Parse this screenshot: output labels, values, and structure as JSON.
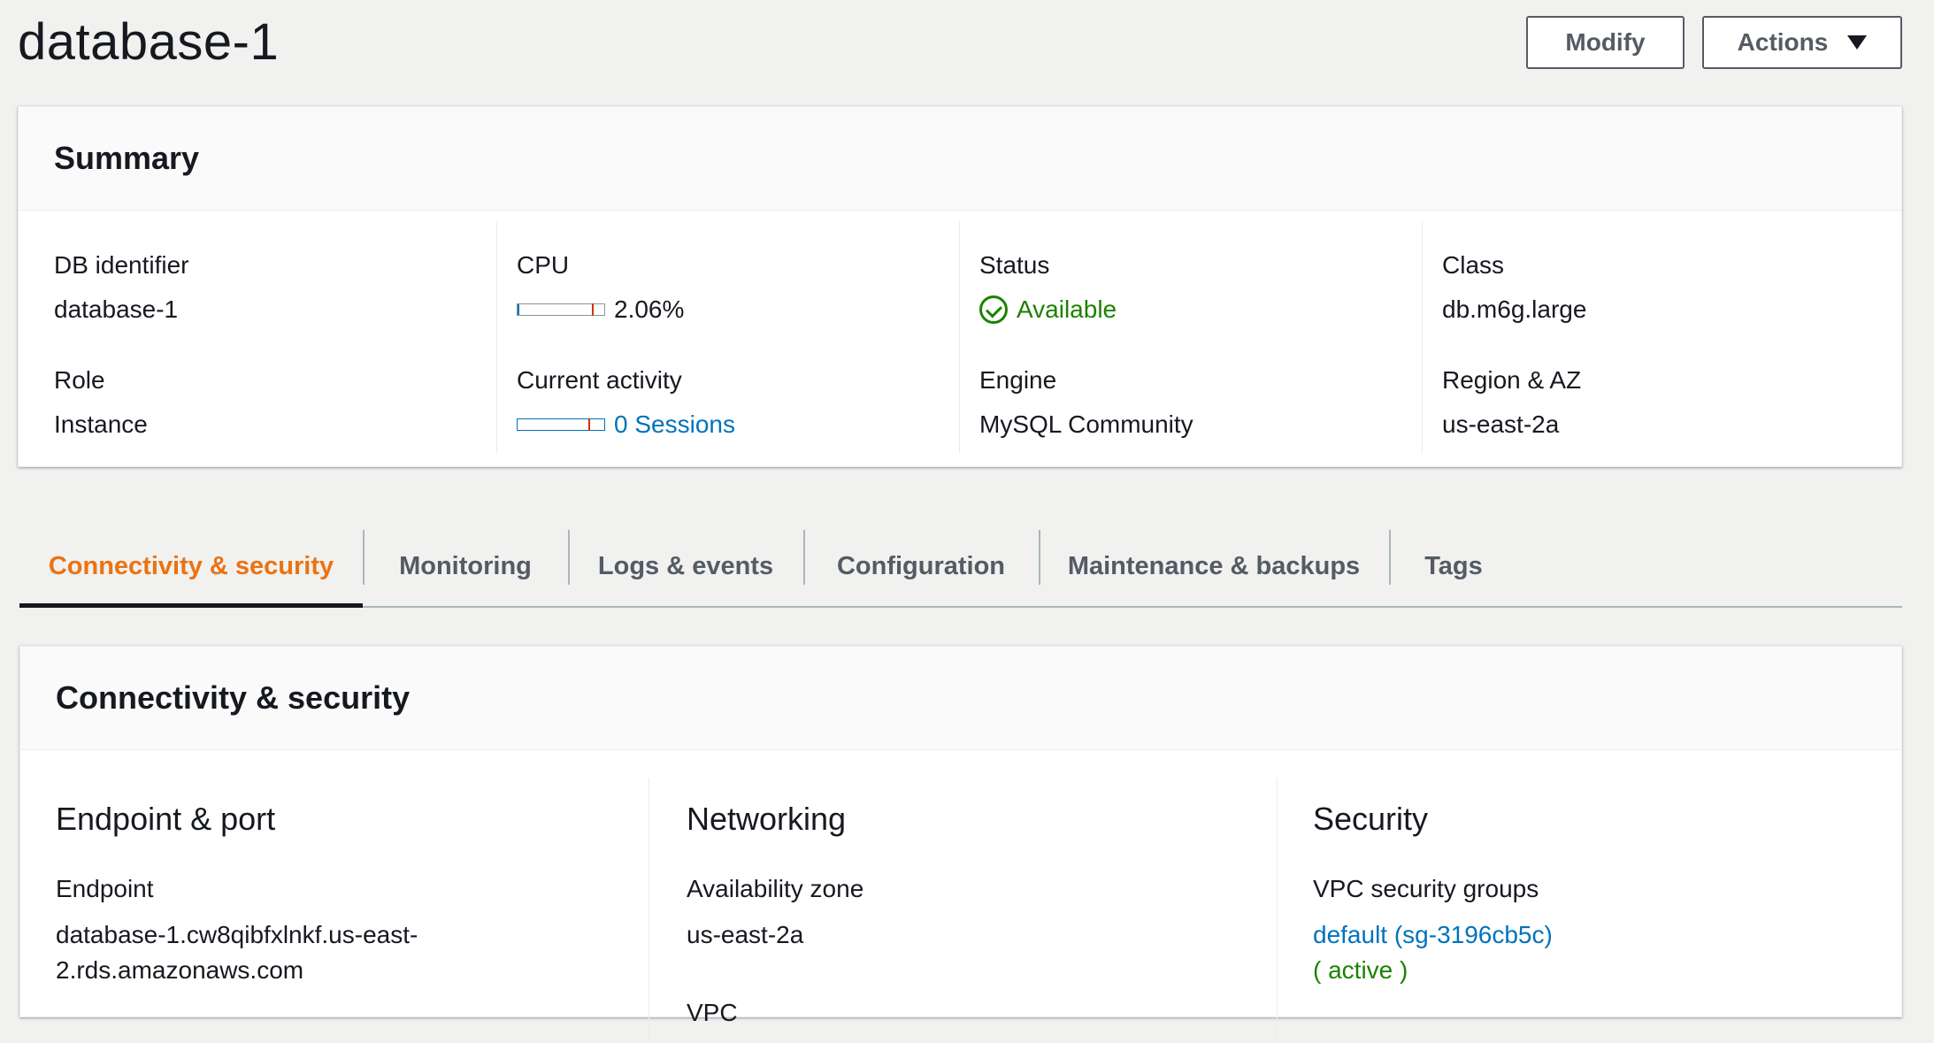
{
  "header": {
    "title": "database-1",
    "modify_label": "Modify",
    "actions_label": "Actions"
  },
  "summary": {
    "title": "Summary",
    "db_identifier": {
      "label": "DB identifier",
      "value": "database-1"
    },
    "role": {
      "label": "Role",
      "value": "Instance"
    },
    "cpu": {
      "label": "CPU",
      "value": "2.06%",
      "fraction": 0.0206
    },
    "current_activity": {
      "label": "Current activity",
      "value": "0 Sessions"
    },
    "status": {
      "label": "Status",
      "value": "Available",
      "icon": "check-circle-icon",
      "color": "#1d8102"
    },
    "engine": {
      "label": "Engine",
      "value": "MySQL Community"
    },
    "class": {
      "label": "Class",
      "value": "db.m6g.large"
    },
    "region_az": {
      "label": "Region & AZ",
      "value": "us-east-2a"
    }
  },
  "tabs": [
    {
      "label": "Connectivity & security",
      "active": true
    },
    {
      "label": "Monitoring"
    },
    {
      "label": "Logs & events"
    },
    {
      "label": "Configuration"
    },
    {
      "label": "Maintenance & backups"
    },
    {
      "label": "Tags"
    }
  ],
  "connectivity": {
    "title": "Connectivity & security",
    "endpoint_port": {
      "title": "Endpoint & port",
      "endpoint_label": "Endpoint",
      "endpoint_line1": "database-1.cw8qibfxlnkf.us-east-",
      "endpoint_line2": "2.rds.amazonaws.com"
    },
    "networking": {
      "title": "Networking",
      "az_label": "Availability zone",
      "az_value": "us-east-2a",
      "vpc_label": "VPC"
    },
    "security": {
      "title": "Security",
      "sg_label": "VPC security groups",
      "sg_value": "default (sg-3196cb5c)",
      "sg_state": "( active )"
    }
  },
  "colors": {
    "accent_tab": "#ec7211",
    "link": "#0073bb",
    "success": "#1d8102"
  }
}
